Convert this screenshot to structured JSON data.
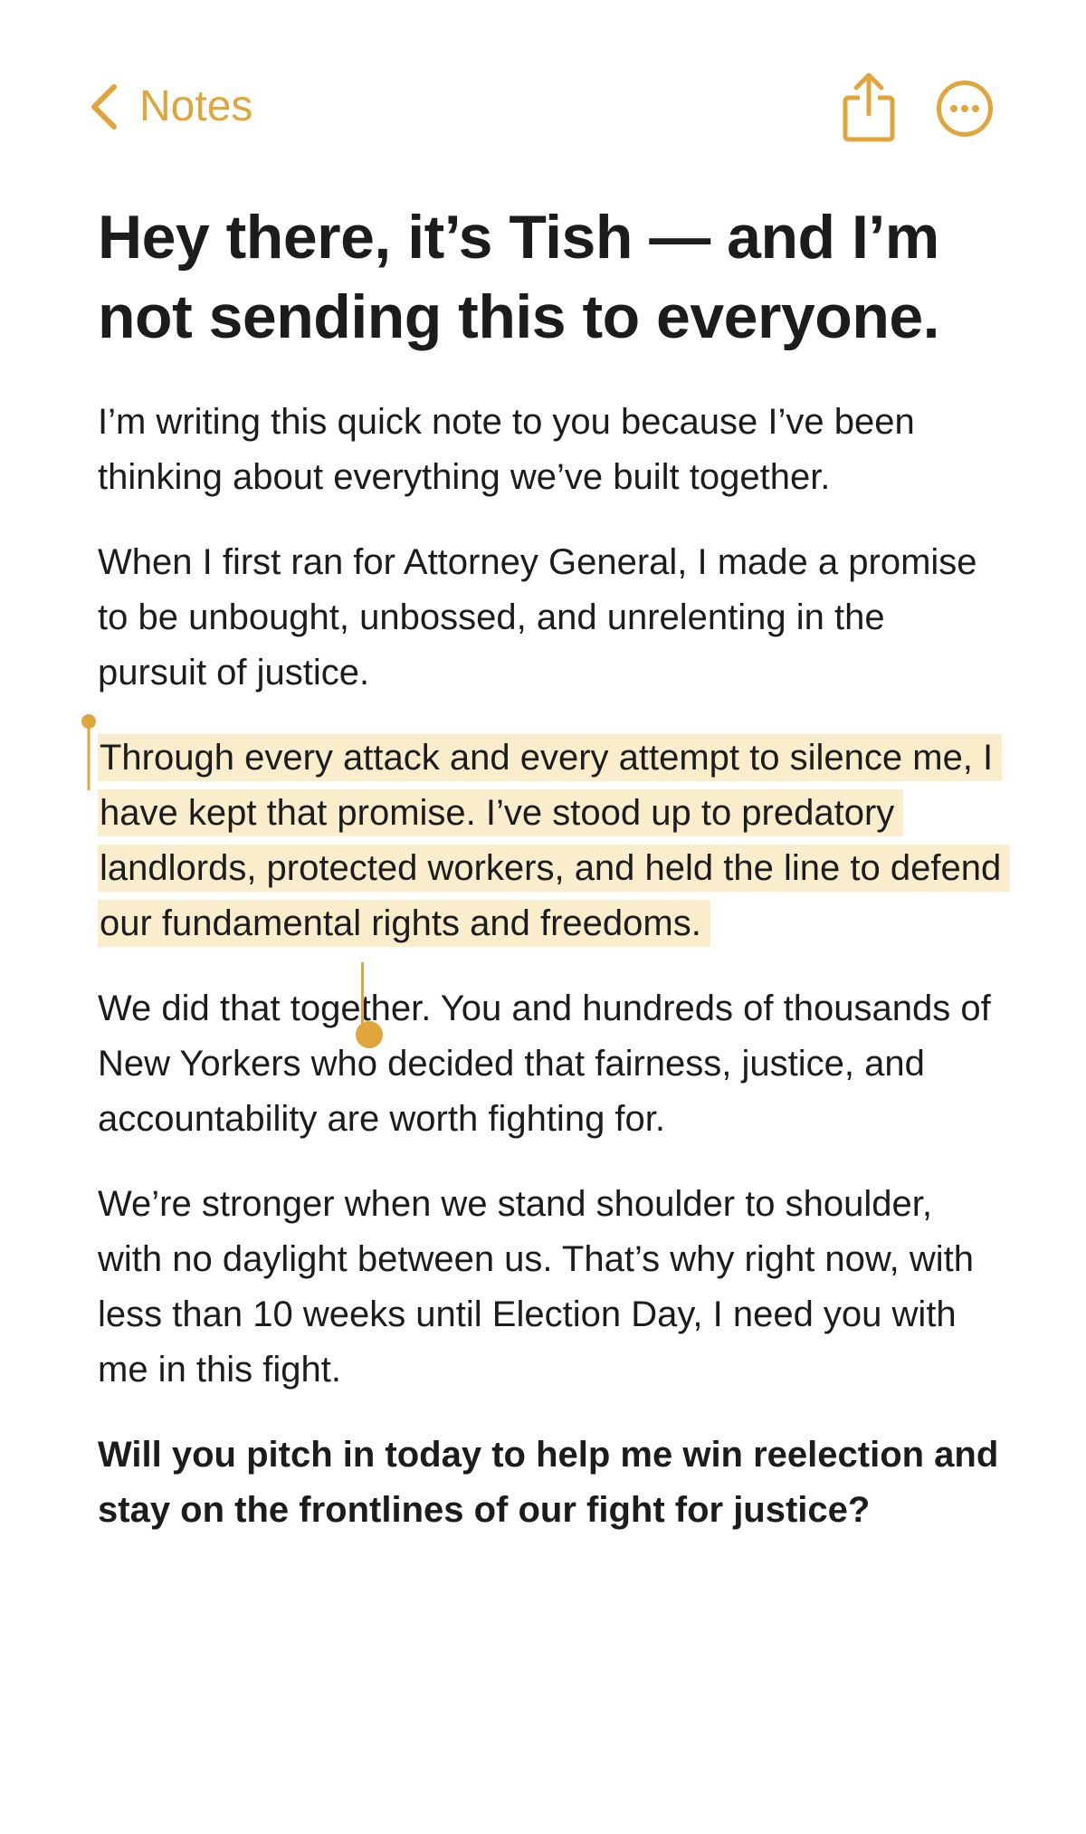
{
  "navbar": {
    "back_label": "Notes",
    "accent_color": "#e0a53b",
    "back_icon": "chevron-left-icon",
    "share_icon": "share-icon",
    "more_icon": "ellipsis-circle-icon"
  },
  "note": {
    "title": "Hey there, it’s Tish — and I’m not sending this to everyone.",
    "paragraphs": [
      "I’m writing this quick note to you because I’ve been thinking about everything we’ve built together.",
      "When I first ran for Attorney General, I made a promise to be unbought, unbossed, and unrelenting in the pursuit of justice.",
      "Through every attack and every attempt to silence me, I have kept that promise. I’ve stood up to predatory landlords, protected workers, and held the line to defend our fundamental rights and freedoms.",
      "We did that together. You and hundreds of thousands of New Yorkers who decided that fairness, justice, and accountability are worth fighting for.",
      "We’re stronger when we stand shoulder to shoulder, with no daylight between us. That’s why right now, with less than 10 weeks until Election Day, I need you with me in this fight.",
      "Will you pitch in today to help me win reelection and stay on the frontlines of our fight for justice?"
    ],
    "selection_highlight_color": "#faedcc"
  }
}
